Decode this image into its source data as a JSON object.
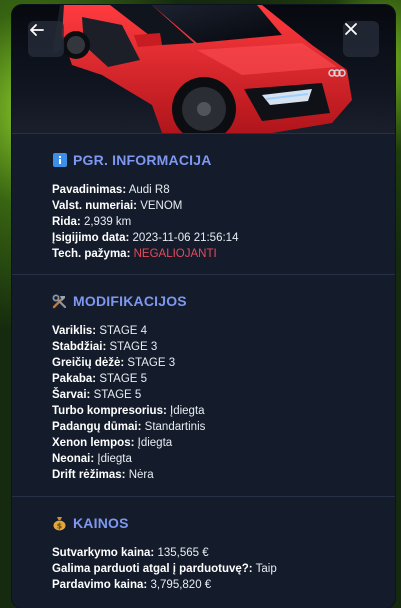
{
  "header": {
    "icons": {
      "back": "arrow-left-icon",
      "close": "close-icon"
    }
  },
  "colors": {
    "accent": "#7e97f0",
    "danger": "#e8495b",
    "card_bg": "#141c2b",
    "car_red": "#e3262c"
  },
  "sections": {
    "info": {
      "icon": "info-icon",
      "title": "PGR. INFORMACIJA",
      "rows": [
        {
          "key": "Pavadinimas:",
          "value": "Audi R8"
        },
        {
          "key": "Valst. numeriai:",
          "value": "VENOM"
        },
        {
          "key": "Rida:",
          "value": "2,939 km"
        },
        {
          "key": "Įsigijimo data:",
          "value": "2023-11-06 21:56:14"
        },
        {
          "key": "Tech. pažyma:",
          "value": "NEGALIOJANTI"
        }
      ]
    },
    "mods": {
      "icon": "tools-icon",
      "title": "MODIFIKACIJOS",
      "rows": [
        {
          "key": "Variklis:",
          "value": "STAGE 4"
        },
        {
          "key": "Stabdžiai:",
          "value": "STAGE 3"
        },
        {
          "key": "Greičių dėžė:",
          "value": "STAGE 3"
        },
        {
          "key": "Pakaba:",
          "value": "STAGE 5"
        },
        {
          "key": "Šarvai:",
          "value": "STAGE 5"
        },
        {
          "key": "Turbo kompresorius:",
          "value": "Įdiegta"
        },
        {
          "key": "Padangų dūmai:",
          "value": "Standartinis"
        },
        {
          "key": "Xenon lempos:",
          "value": "Įdiegta"
        },
        {
          "key": "Neonai:",
          "value": "Įdiegta"
        },
        {
          "key": "Drift rėžimas:",
          "value": "Nėra"
        }
      ]
    },
    "prices": {
      "icon": "money-bag-icon",
      "title": "KAINOS",
      "rows": [
        {
          "key": "Sutvarkymo kaina:",
          "value": "135,565 €"
        },
        {
          "key": "Galima parduoti atgal į parduotuvę?:",
          "value": "Taip"
        },
        {
          "key": "Pardavimo kaina:",
          "value": "3,795,820 €"
        }
      ]
    }
  }
}
